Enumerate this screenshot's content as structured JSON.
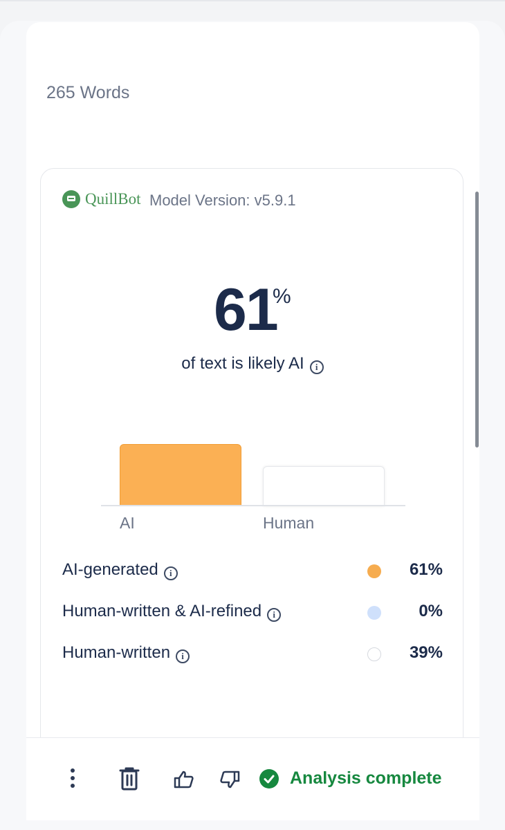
{
  "word_count": "265 Words",
  "brand": {
    "name": "QuillBot",
    "model_version": "Model Version: v5.9.1"
  },
  "result": {
    "percent": "61",
    "percent_sign": "%",
    "subtitle": "of text is likely AI"
  },
  "chart_data": {
    "type": "bar",
    "categories": [
      "AI",
      "Human"
    ],
    "values": [
      61,
      39
    ],
    "colors": [
      "#fbb054",
      "#ffffff"
    ],
    "ylim": [
      0,
      100
    ],
    "grid": false
  },
  "legend": [
    {
      "label": "AI-generated",
      "value": "61%",
      "color": "#f6ac4f"
    },
    {
      "label": "Human-written & AI-refined",
      "value": "0%",
      "color": "#cfe0fb"
    },
    {
      "label": "Human-written",
      "value": "39%",
      "color": "#ffffff"
    }
  ],
  "footer": {
    "status": "Analysis complete",
    "status_color": "#16883f"
  },
  "icons": [
    "more-vertical-icon",
    "trash-icon",
    "thumbs-up-icon",
    "thumbs-down-icon",
    "check-circle-icon",
    "info-icon"
  ]
}
